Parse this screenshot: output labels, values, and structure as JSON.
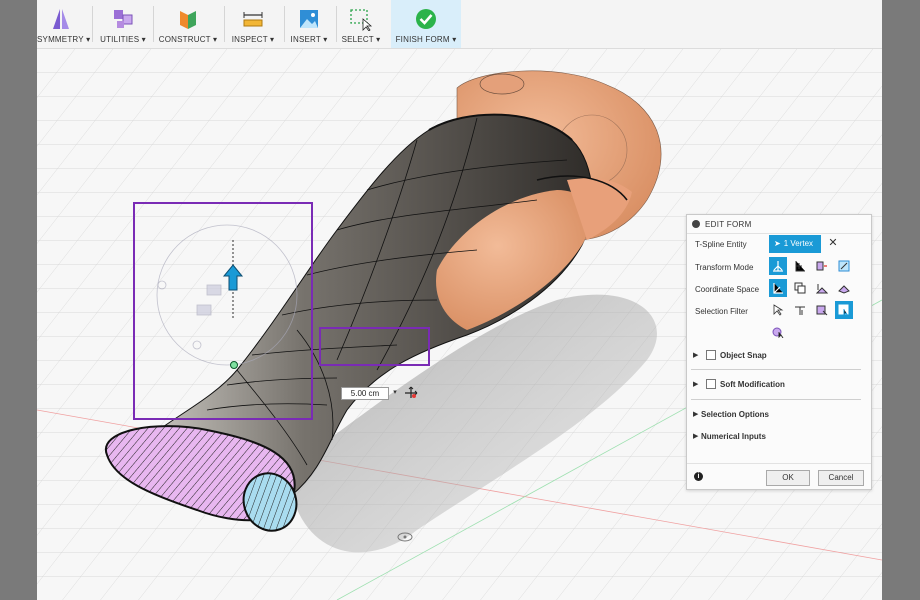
{
  "toolbar": {
    "items": [
      {
        "label": "SYMMETRY ▾",
        "icon": "symmetry-icon"
      },
      {
        "label": "UTILITIES ▾",
        "icon": "utilities-icon"
      },
      {
        "label": "CONSTRUCT ▾",
        "icon": "construct-icon"
      },
      {
        "label": "INSPECT ▾",
        "icon": "inspect-icon"
      },
      {
        "label": "INSERT ▾",
        "icon": "insert-icon"
      },
      {
        "label": "SELECT ▾",
        "icon": "select-icon"
      },
      {
        "label": "FINISH FORM ▾",
        "icon": "finish-form-icon"
      }
    ],
    "finish_color": "#2bb34a"
  },
  "dimension": {
    "value": "5.00 cm",
    "dropdown": "▾"
  },
  "panel": {
    "title": "EDIT FORM",
    "tspline_label": "T-Spline Entity",
    "vertex_label": "1 Vertex",
    "close_symbol": "✕",
    "transform_label": "Transform Mode",
    "coordinate_label": "Coordinate Space",
    "selection_filter_label": "Selection Filter",
    "object_snap": "Object Snap",
    "soft_modification": "Soft Modification",
    "selection_options": "Selection Options",
    "numerical_inputs": "Numerical Inputs",
    "ok": "OK",
    "cancel": "Cancel",
    "info": "i",
    "accent": "#1a9ad6"
  },
  "colors": {
    "selection_box": "#7a2bb5",
    "skin": "#e9a57d",
    "metal": "#6f6b65",
    "hatch_pink": "#e8b7f0",
    "hatch_blue": "#a9dcef"
  }
}
